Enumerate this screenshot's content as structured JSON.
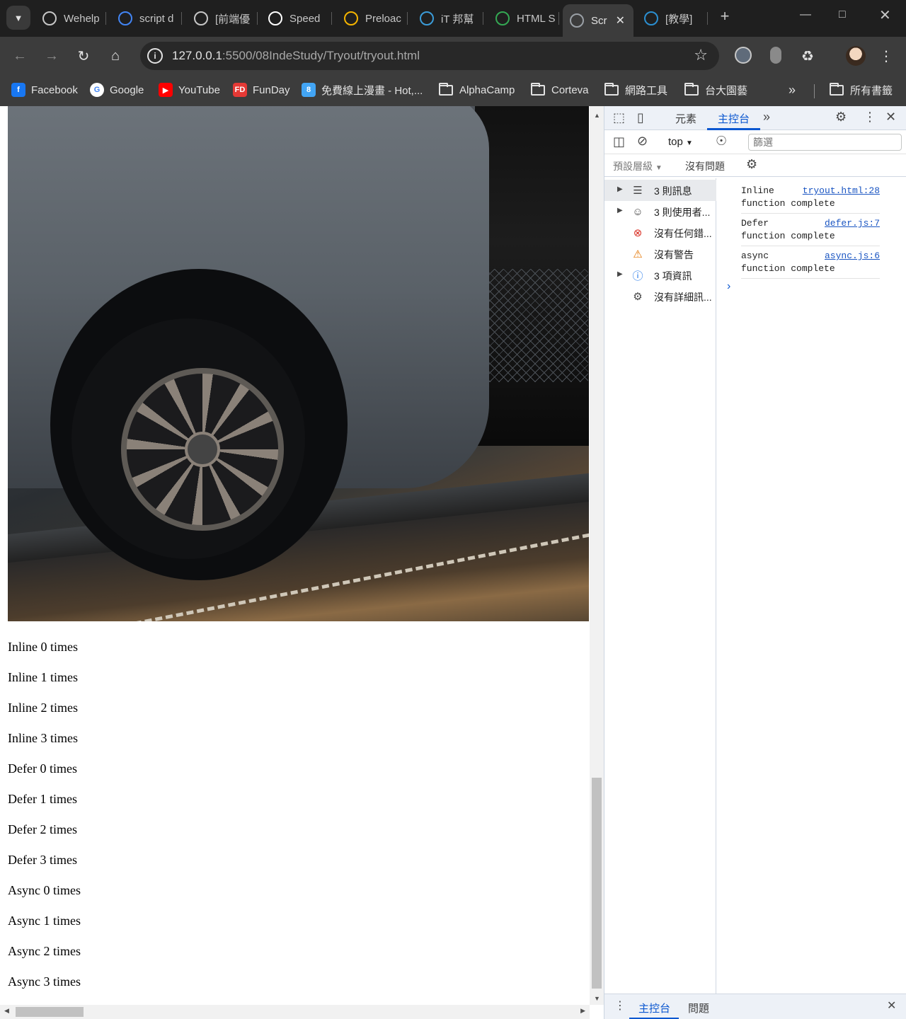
{
  "browser": {
    "tabs": [
      {
        "title": "Wehelp",
        "favicon": "spinner-icon",
        "color": "#c7c7c7"
      },
      {
        "title": "script d",
        "favicon": "google-icon",
        "color": "#4285f4"
      },
      {
        "title": "[前端優",
        "favicon": "link-icon",
        "color": "#c7c7c7"
      },
      {
        "title": "Speed",
        "favicon": "medium-icon",
        "color": "#ffffff"
      },
      {
        "title": "Preloac",
        "favicon": "flower-icon",
        "color": "#f4b400"
      },
      {
        "title": "iT 邦幫",
        "favicon": "ithome-icon",
        "color": "#3b9cd9"
      },
      {
        "title": "HTML S",
        "favicon": "help-icon",
        "color": "#34a853"
      },
      {
        "title": "Scr",
        "favicon": "globe-icon",
        "color": "#9aa0a6",
        "active": true
      },
      {
        "title": "[教學]",
        "favicon": "s-icon",
        "color": "#2b8fd1"
      }
    ],
    "address": {
      "host": "127.0.0.1",
      "path": ":5500/08IndeStudy/Tryout/tryout.html"
    },
    "bookmarks": [
      {
        "label": "Facebook",
        "icon": "facebook-icon",
        "color": "#1877f2",
        "glyph": "f"
      },
      {
        "label": "Google",
        "icon": "google-icon",
        "color": "#ffffff",
        "glyph": "G"
      },
      {
        "label": "YouTube",
        "icon": "youtube-icon",
        "color": "#ff0000",
        "glyph": "▶"
      },
      {
        "label": "FunDay",
        "icon": "funday-icon",
        "color": "#e53935",
        "glyph": "FD"
      },
      {
        "label": "免費線上漫畫 - Hot,...",
        "icon": "manga-icon",
        "color": "#42a5f5",
        "glyph": "8"
      },
      {
        "label": "AlphaCamp",
        "icon": "folder-icon"
      },
      {
        "label": "Corteva",
        "icon": "folder-icon"
      },
      {
        "label": "網路工具",
        "icon": "folder-icon"
      },
      {
        "label": "台大園藝",
        "icon": "folder-icon"
      }
    ],
    "all_bookmarks_label": "所有書籤"
  },
  "page": {
    "lines": [
      "Inline 0 times",
      "Inline 1 times",
      "Inline 2 times",
      "Inline 3 times",
      "Defer 0 times",
      "Defer 1 times",
      "Defer 2 times",
      "Defer 3 times",
      "Async 0 times",
      "Async 1 times",
      "Async 2 times",
      "Async 3 times"
    ]
  },
  "devtools": {
    "tabs": {
      "elements": "元素",
      "console": "主控台"
    },
    "context": "top",
    "filter_placeholder": "篩選",
    "levels": "預設層級",
    "issues": "沒有問題",
    "sidebar": [
      {
        "label": "3 則訊息",
        "icon": "list-icon",
        "expandable": true,
        "selected": true
      },
      {
        "label": "3 則使用者...",
        "icon": "user-icon",
        "expandable": true
      },
      {
        "label": "沒有任何錯...",
        "icon": "error-icon",
        "expandable": false
      },
      {
        "label": "沒有警告",
        "icon": "warning-icon",
        "expandable": false
      },
      {
        "label": "3 項資訊",
        "icon": "info-icon",
        "expandable": true
      },
      {
        "label": "沒有詳細訊...",
        "icon": "bug-icon",
        "expandable": false
      }
    ],
    "messages": [
      {
        "line1": "Inline",
        "line2": "function complete",
        "source": "tryout.html:28"
      },
      {
        "line1": "Defer",
        "line2": "function complete",
        "source": "defer.js:7"
      },
      {
        "line1": "async",
        "line2": "function complete",
        "source": "async.js:6"
      }
    ],
    "drawer": {
      "console": "主控台",
      "issues": "問題"
    }
  }
}
